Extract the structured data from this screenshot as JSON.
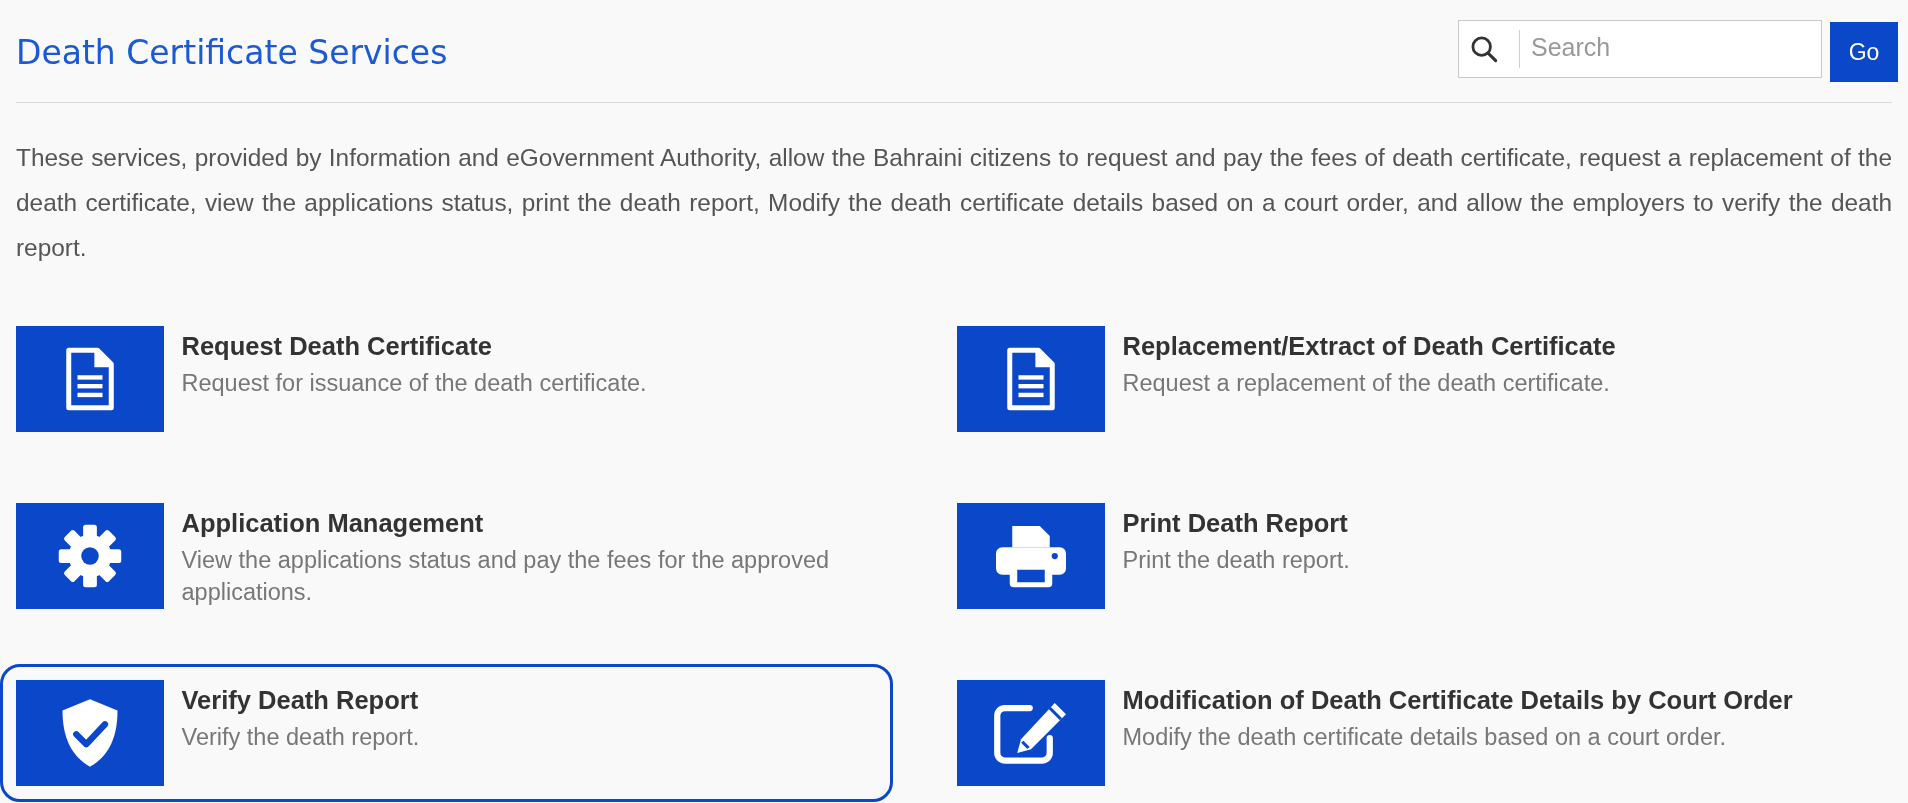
{
  "page_title": "Death Certificate Services",
  "search": {
    "placeholder": "Search",
    "button": "Go"
  },
  "description": "These services, provided by Information and eGovernment Authority, allow the Bahraini citizens to request and pay the fees of death certificate, request a replacement of the death certificate, view the applications status, print the death report, Modify the death certificate details based on a court order, and allow the employers to verify the death report.",
  "services": [
    {
      "title": "Request Death Certificate",
      "description": "Request for issuance of the death certificate.",
      "highlighted": false
    },
    {
      "title": "Replacement/Extract of Death Certificate",
      "description": "Request a replacement of the death certificate.",
      "highlighted": false
    },
    {
      "title": "Application Management",
      "description": "View the applications status and pay the fees for the approved applications.",
      "highlighted": false
    },
    {
      "title": "Print Death Report",
      "description": "Print the death report.",
      "highlighted": false
    },
    {
      "title": "Verify Death Report",
      "description": "Verify the death report.",
      "highlighted": true
    },
    {
      "title": "Modification of Death Certificate Details by Court Order",
      "description": "Modify the death certificate details based on a court order.",
      "highlighted": false
    }
  ]
}
